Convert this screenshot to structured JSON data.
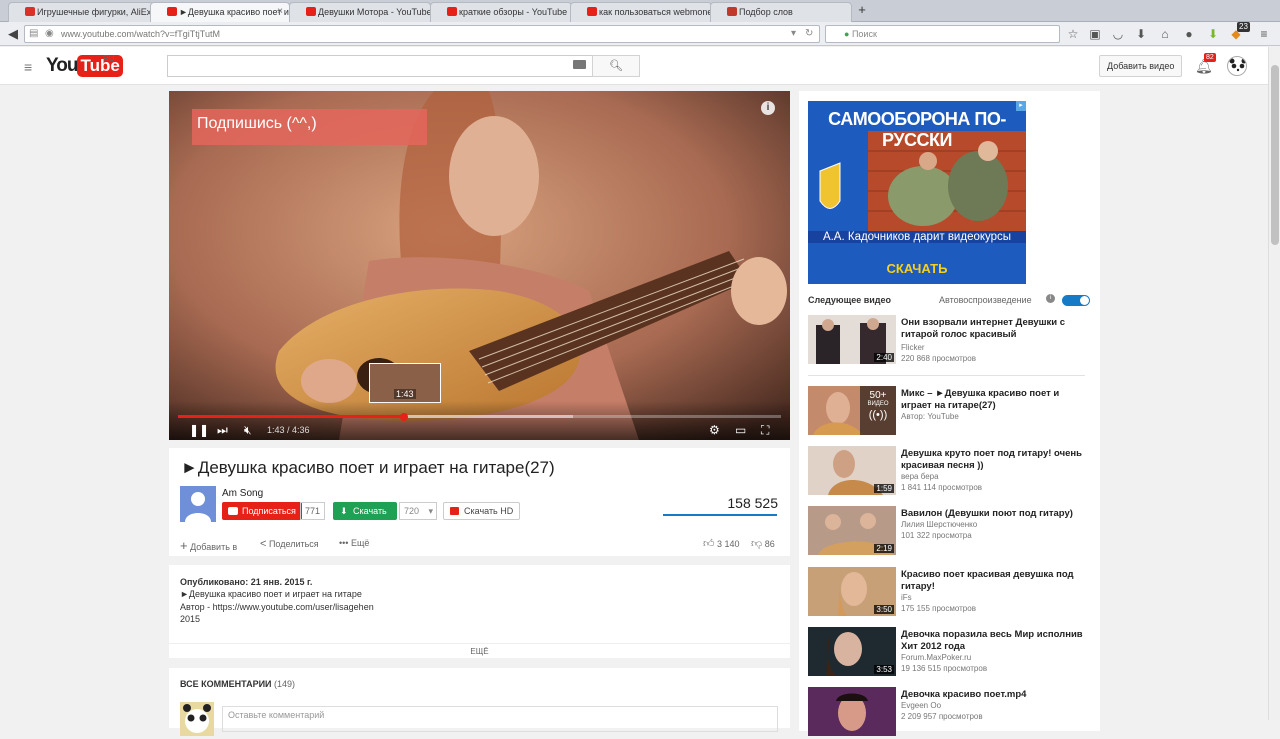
{
  "browser": {
    "tabs": [
      {
        "label": "Игрушечные фигурки, AliEx...",
        "color": "#d9302a",
        "active": false
      },
      {
        "label": "►Девушка красиво поет и ...",
        "color": "#e62117",
        "active": true
      },
      {
        "label": "Девушки Мотора - YouTube",
        "color": "#e62117",
        "active": false
      },
      {
        "label": "краткие обзоры - YouTube",
        "color": "#e62117",
        "active": false
      },
      {
        "label": "как пользоваться webmone...",
        "color": "#e62117",
        "active": false
      },
      {
        "label": "Подбор слов",
        "color": "#c0392b",
        "active": false
      }
    ],
    "new_tab": "+",
    "url": "www.youtube.com/watch?v=fTgiTtjTutM",
    "search_placeholder": "Поиск",
    "ext_badge": "23"
  },
  "header": {
    "logo_you": "You",
    "logo_tube": "Tube",
    "logo_region": "RU",
    "search_placeholder": "",
    "upload_label": "Добавить видео",
    "notifications": "82"
  },
  "player": {
    "annotation": "Подпишись (^^,)",
    "info": "i",
    "time": "1:43 / 4:36",
    "preview_time": "1:43",
    "progress": 0.375,
    "buffered": 0.655
  },
  "video": {
    "title": "►Девушка красиво поет и играет на гитаре(27)",
    "channel": "Am Song",
    "subscribe_label": "Подписаться",
    "subscribers": "771",
    "download_label": "Скачать",
    "quality": "720",
    "download_hd": "Скачать HD",
    "views": "158 525",
    "add_to": "Добавить в",
    "share": "Поделиться",
    "more": "Ещё",
    "likes": "3 140",
    "dislikes": "86"
  },
  "description": {
    "published": "Опубликовано: 21 янв. 2015 г.",
    "lines": [
      "►Девушка красиво поет и играет на гитаре",
      "Автор - https://www.youtube.com/user/lisagehen",
      "2015"
    ],
    "more": "ЕЩЁ"
  },
  "comments": {
    "title": "ВСЕ КОММЕНТАРИИ",
    "count": "(149)",
    "placeholder": "Оставьте комментарий"
  },
  "ad": {
    "title": "САМООБОРОНА ПО-РУССКИ",
    "subtitle": "А.А. Кадочников дарит видеокурсы",
    "cta": "СКАЧАТЬ"
  },
  "sidebar": {
    "next_label": "Следующее видео",
    "autoplay_label": "Автовоспроизведение",
    "items": [
      {
        "title": "Они взорвали интернет Девушки с гитарой голос красивый",
        "author": "Flicker",
        "views": "220 868 просмотров",
        "duration": "2:40"
      },
      {
        "title": "Микс – ►Девушка красиво поет и играет на гитаре(27)",
        "author": "Автор: YouTube",
        "views": "",
        "duration": "",
        "mix_count": "50+",
        "mix_label": "ВИДЕО"
      },
      {
        "title": "Девушка круто поет под гитару! очень красивая песня ))",
        "author": "вера бера",
        "views": "1 841 114 просмотров",
        "duration": "1:59"
      },
      {
        "title": "Вавилон (Девушки поют под гитару)",
        "author": "Лилия Шерстюченко",
        "views": "101 322 просмотра",
        "duration": "2:19"
      },
      {
        "title": "Красиво поет красивая девушка под гитару!",
        "author": "iFs",
        "views": "175 155 просмотров",
        "duration": "3:50"
      },
      {
        "title": "Девочка поразила весь Мир исполнив Хит 2012 года",
        "author": "Forum.MaxPoker.ru",
        "views": "19 136 515 просмотров",
        "duration": "3:53"
      },
      {
        "title": "Девочка красиво поет.mp4",
        "author": "Evgeen Oo",
        "views": "2 209 957 просмотров",
        "duration": ""
      }
    ]
  }
}
